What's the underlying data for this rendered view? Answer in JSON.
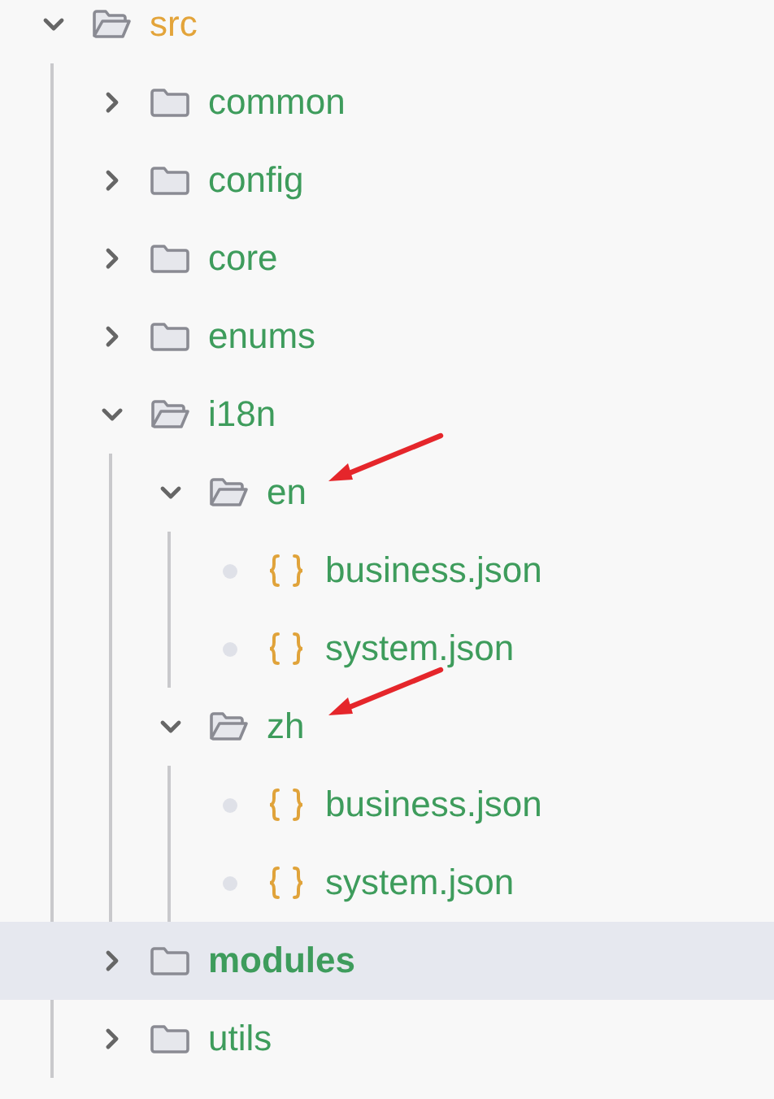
{
  "tree": [
    {
      "kind": "folder",
      "name": "src",
      "expanded": true,
      "selected": false,
      "annotated": false,
      "children": [
        {
          "kind": "folder",
          "name": "common",
          "expanded": false,
          "selected": false,
          "annotated": false
        },
        {
          "kind": "folder",
          "name": "config",
          "expanded": false,
          "selected": false,
          "annotated": false
        },
        {
          "kind": "folder",
          "name": "core",
          "expanded": false,
          "selected": false,
          "annotated": false
        },
        {
          "kind": "folder",
          "name": "enums",
          "expanded": false,
          "selected": false,
          "annotated": false
        },
        {
          "kind": "folder",
          "name": "i18n",
          "expanded": true,
          "selected": false,
          "annotated": false,
          "children": [
            {
              "kind": "folder",
              "name": "en",
              "expanded": true,
              "selected": false,
              "annotated": true,
              "children": [
                {
                  "kind": "file",
                  "name": "business.json",
                  "selected": false
                },
                {
                  "kind": "file",
                  "name": "system.json",
                  "selected": false
                }
              ]
            },
            {
              "kind": "folder",
              "name": "zh",
              "expanded": true,
              "selected": false,
              "annotated": true,
              "children": [
                {
                  "kind": "file",
                  "name": "business.json",
                  "selected": false
                },
                {
                  "kind": "file",
                  "name": "system.json",
                  "selected": false
                }
              ]
            }
          ]
        },
        {
          "kind": "folder",
          "name": "modules",
          "expanded": false,
          "selected": true,
          "annotated": false
        },
        {
          "kind": "folder",
          "name": "utils",
          "expanded": false,
          "selected": false,
          "annotated": false
        }
      ]
    }
  ]
}
